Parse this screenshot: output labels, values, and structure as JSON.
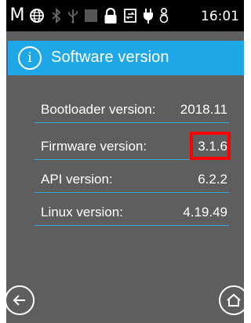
{
  "status_bar": {
    "mode_letter": "M",
    "icons": [
      "globe-icon",
      "bluetooth-icon",
      "usb-icon",
      "signal-icon",
      "lock-icon",
      "sync-icon",
      "power-plug-icon",
      "audio-icon"
    ],
    "clock": "16:01"
  },
  "header": {
    "icon": "info-icon",
    "title": "Software version"
  },
  "versions": [
    {
      "label": "Bootloader version:",
      "value": "2018.11"
    },
    {
      "label": "Firmware version:",
      "value": "3.1.6"
    },
    {
      "label": "API version:",
      "value": "6.2.2"
    },
    {
      "label": "Linux version:",
      "value": "4.19.49"
    }
  ],
  "colors": {
    "background": "#5e5e5e",
    "header": "#1ea8e8",
    "divider": "#3aa6e0",
    "highlight": "#ff0000"
  },
  "nav": {
    "back_icon": "back-arrow-icon",
    "home_icon": "home-icon"
  }
}
